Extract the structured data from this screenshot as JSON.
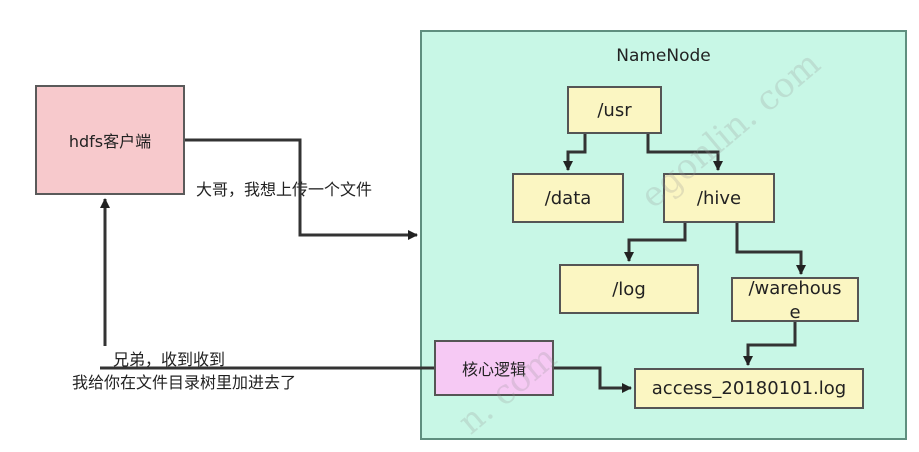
{
  "namenode": {
    "title": "NameNode"
  },
  "client": {
    "label": "hdfs客户端"
  },
  "request_message": "大哥，我想上传一个文件",
  "reply_message": {
    "line1": "兄弟，收到收到",
    "line2": "我给你在文件目录树里加进去了"
  },
  "core_logic": {
    "label": "核心逻辑"
  },
  "directories": {
    "usr": "/usr",
    "data": "/data",
    "hive": "/hive",
    "log": "/log",
    "warehouse_line1": "/warehous",
    "warehouse_line2": "e",
    "access_file": "access_20180101.log"
  },
  "watermark": {
    "top": "egonlin. com",
    "bottom": "n. com"
  },
  "colors": {
    "namenode_bg": "#c8f7e6",
    "client_bg": "#f7c9cc",
    "dir_bg": "#fbf6c2",
    "core_bg": "#f6c9f4"
  }
}
